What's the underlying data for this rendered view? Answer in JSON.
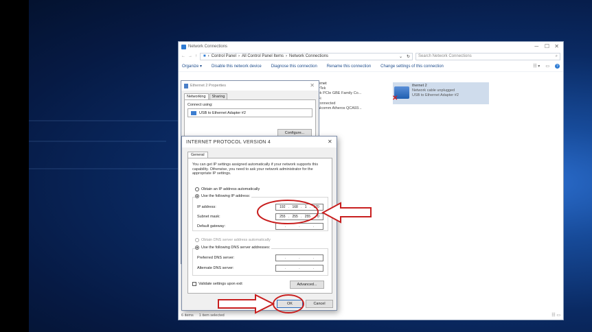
{
  "network_connections": {
    "title": "Network Connections",
    "breadcrumb": [
      "Control Panel",
      "All Control Panel Items",
      "Network Connections"
    ],
    "search_placeholder": "Search Network Connections",
    "toolbar": {
      "organize": "Organize ▾",
      "disable": "Disable this network device",
      "diagnose": "Diagnose this connection",
      "rename": "Rename this connection",
      "change": "Change settings of this connection"
    },
    "connection_text": {
      "l1": "hernet",
      "l2": "eyTek",
      "l3": "ltek PCIe GBE Family Co...",
      "l4": "i-Fi",
      "l5": "t connected",
      "l6": "ualcomm Atheros QCA93..."
    },
    "ethernet2": {
      "name": "thernet 2",
      "status": "Network cable unplugged",
      "device": "USB to Ethernet Adapter #2"
    },
    "status_bar": {
      "items": "6 items",
      "selected": "1 item selected"
    }
  },
  "ethernet_props": {
    "title": "Ethernet 2 Properties",
    "tabs": [
      "Networking",
      "Sharing"
    ],
    "connect_using": "Connect using:",
    "adapter": "USB to Ethernet Adapter #2",
    "configure": "Configure..."
  },
  "ipv4": {
    "title": "INTERNET PROTOCOL VERSION 4",
    "tab": "General",
    "description": "You can get IP settings assigned automatically if your network supports this capability. Otherwise, you need to ask your network administrator for the appropriate IP settings.",
    "obtain_ip": "Obtain an IP address automatically",
    "use_ip": "Use the following IP address:",
    "ip_label": "IP address:",
    "ip": [
      "192",
      "168",
      "1",
      "170"
    ],
    "mask_label": "Subnet mask:",
    "mask": [
      "255",
      "255",
      "255",
      "0"
    ],
    "gateway_label": "Default gateway:",
    "obtain_dns": "Obtain DNS server address automatically",
    "use_dns": "Use the following DNS server addresses:",
    "preferred_label": "Preferred DNS server:",
    "alternate_label": "Alternate DNS server:",
    "validate": "Validate settings upon exit",
    "advanced": "Advanced...",
    "ok": "OK",
    "cancel": "Cancel"
  },
  "colors": {
    "annotation": "#c81e1e",
    "link": "#1d4c8c",
    "selection": "#cfdcec"
  }
}
